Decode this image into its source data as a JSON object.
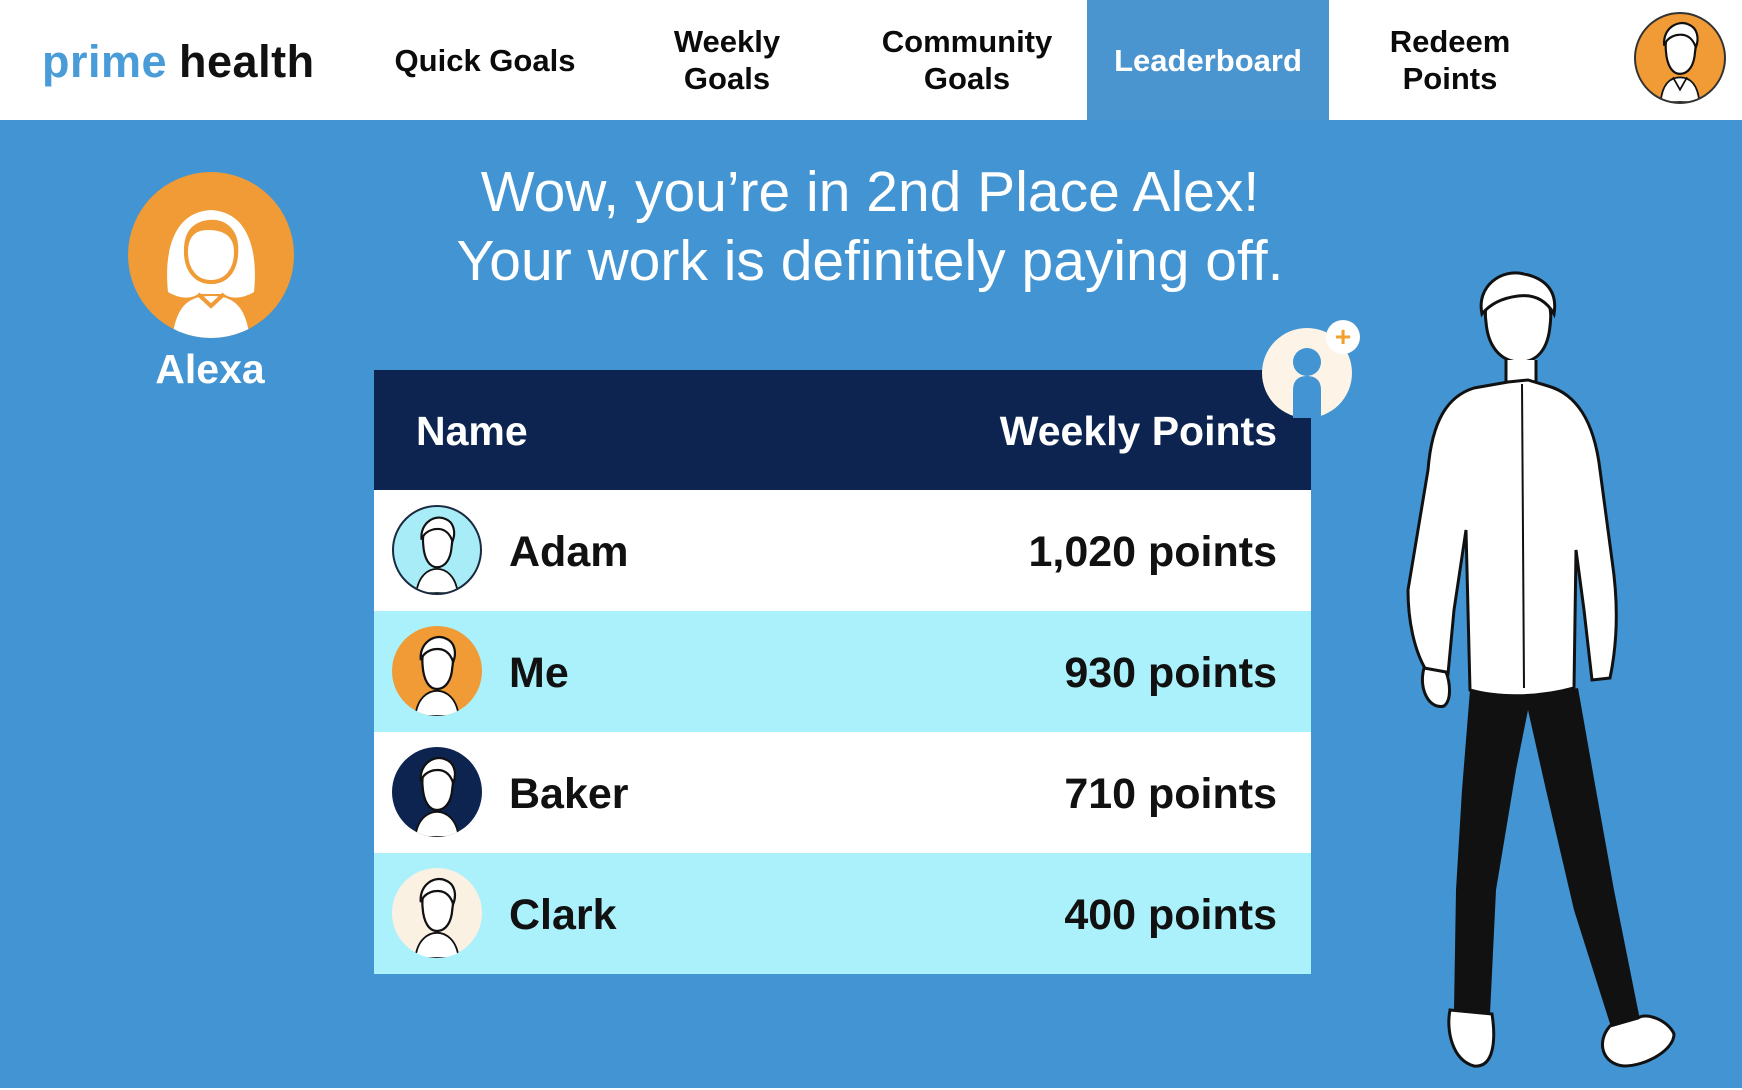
{
  "logo": {
    "part1": "prime",
    "part2": "health"
  },
  "nav": {
    "items": [
      {
        "label": "Quick Goals"
      },
      {
        "label": "Weekly\nGoals"
      },
      {
        "label": "Community\nGoals"
      },
      {
        "label": "Leaderboard",
        "active": true
      },
      {
        "label": "Redeem\nPoints"
      }
    ]
  },
  "coach": {
    "name": "Alexa"
  },
  "headline": {
    "line1": "Wow, you’re in 2nd Place Alex!",
    "line2": "Your work is definitely paying off."
  },
  "leaderboard": {
    "headers": {
      "name": "Name",
      "points": "Weekly Points"
    },
    "rows": [
      {
        "name": "Adam",
        "points": "1,020 points",
        "avatar_color": "#a7ecf7"
      },
      {
        "name": "Me",
        "points": "930 points",
        "avatar_color": "#f09b35"
      },
      {
        "name": "Baker",
        "points": "710 points",
        "avatar_color": "#0d2450"
      },
      {
        "name": "Clark",
        "points": "400 points",
        "avatar_color": "#fbf1e3"
      }
    ]
  },
  "add_friend": {
    "icon": "add-friend-icon",
    "plus": "+"
  },
  "colors": {
    "brand_blue": "#4a9cd9",
    "background_blue": "#4294d2",
    "header_navy": "#0d2450",
    "row_cyan": "#aaf1fb",
    "accent_orange": "#f09b35"
  }
}
